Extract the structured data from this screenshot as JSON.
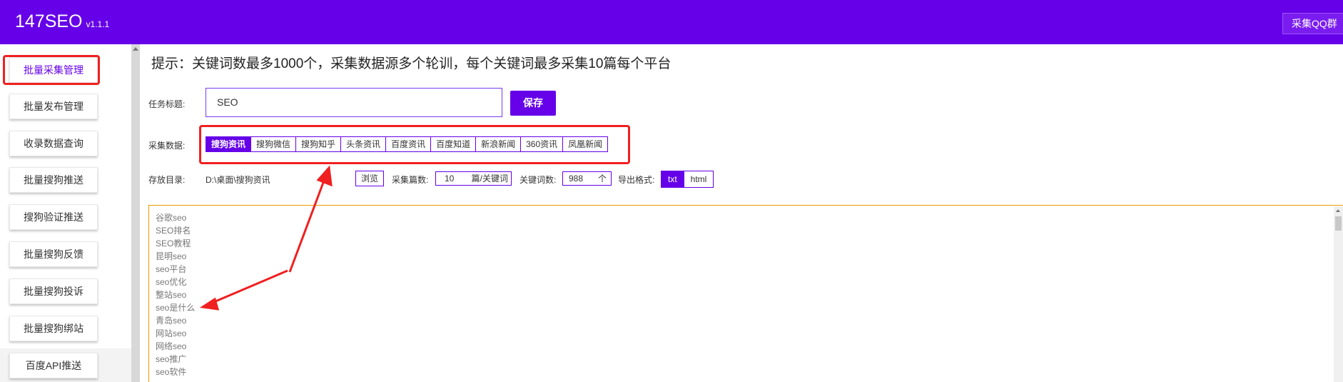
{
  "header": {
    "brand": "147SEO",
    "version": "v1.1.1",
    "qq_button": "采集QQ群"
  },
  "sidebar": {
    "items": [
      {
        "label": "批量采集管理"
      },
      {
        "label": "批量发布管理"
      },
      {
        "label": "收录数据查询"
      },
      {
        "label": "批量搜狗推送"
      },
      {
        "label": "搜狗验证推送"
      },
      {
        "label": "批量搜狗反馈"
      },
      {
        "label": "批量搜狗投诉"
      },
      {
        "label": "批量搜狗绑站"
      },
      {
        "label": "百度API推送"
      }
    ]
  },
  "main": {
    "tip": "提示：关键词数最多1000个，采集数据源多个轮训，每个关键词最多采集10篇每个平台",
    "task_title_label": "任务标题:",
    "task_title_value": "SEO",
    "save_label": "保存",
    "collect_label": "采集数据:",
    "platforms": [
      {
        "label": "搜狗资讯"
      },
      {
        "label": "搜狗微信"
      },
      {
        "label": "搜狗知乎"
      },
      {
        "label": "头条资讯"
      },
      {
        "label": "百度资讯"
      },
      {
        "label": "百度知道"
      },
      {
        "label": "新浪新闻"
      },
      {
        "label": "360资讯"
      },
      {
        "label": "凤凰新闻"
      }
    ],
    "save_dir_label": "存放目录:",
    "save_dir_value": "D:\\桌面\\搜狗资讯",
    "browse_label": "浏览",
    "article_count_label": "采集篇数:",
    "article_count_value": "10",
    "article_count_unit": "篇/关键词",
    "keyword_count_label": "关键词数:",
    "keyword_count_value": "988",
    "keyword_count_unit": "个",
    "export_label": "导出格式:",
    "formats": [
      {
        "label": "txt"
      },
      {
        "label": "html"
      }
    ],
    "keywords": [
      "谷歌seo",
      "SEO排名",
      "SEO教程",
      "昆明seo",
      "seo平台",
      "seo优化",
      "整站seo",
      "seo是什么",
      "青岛seo",
      "网站seo",
      "网络seo",
      "seo推广",
      "seo软件"
    ]
  },
  "colors": {
    "accent": "#6500e8",
    "highlight": "#f02020",
    "textarea_border": "#f09a00"
  }
}
